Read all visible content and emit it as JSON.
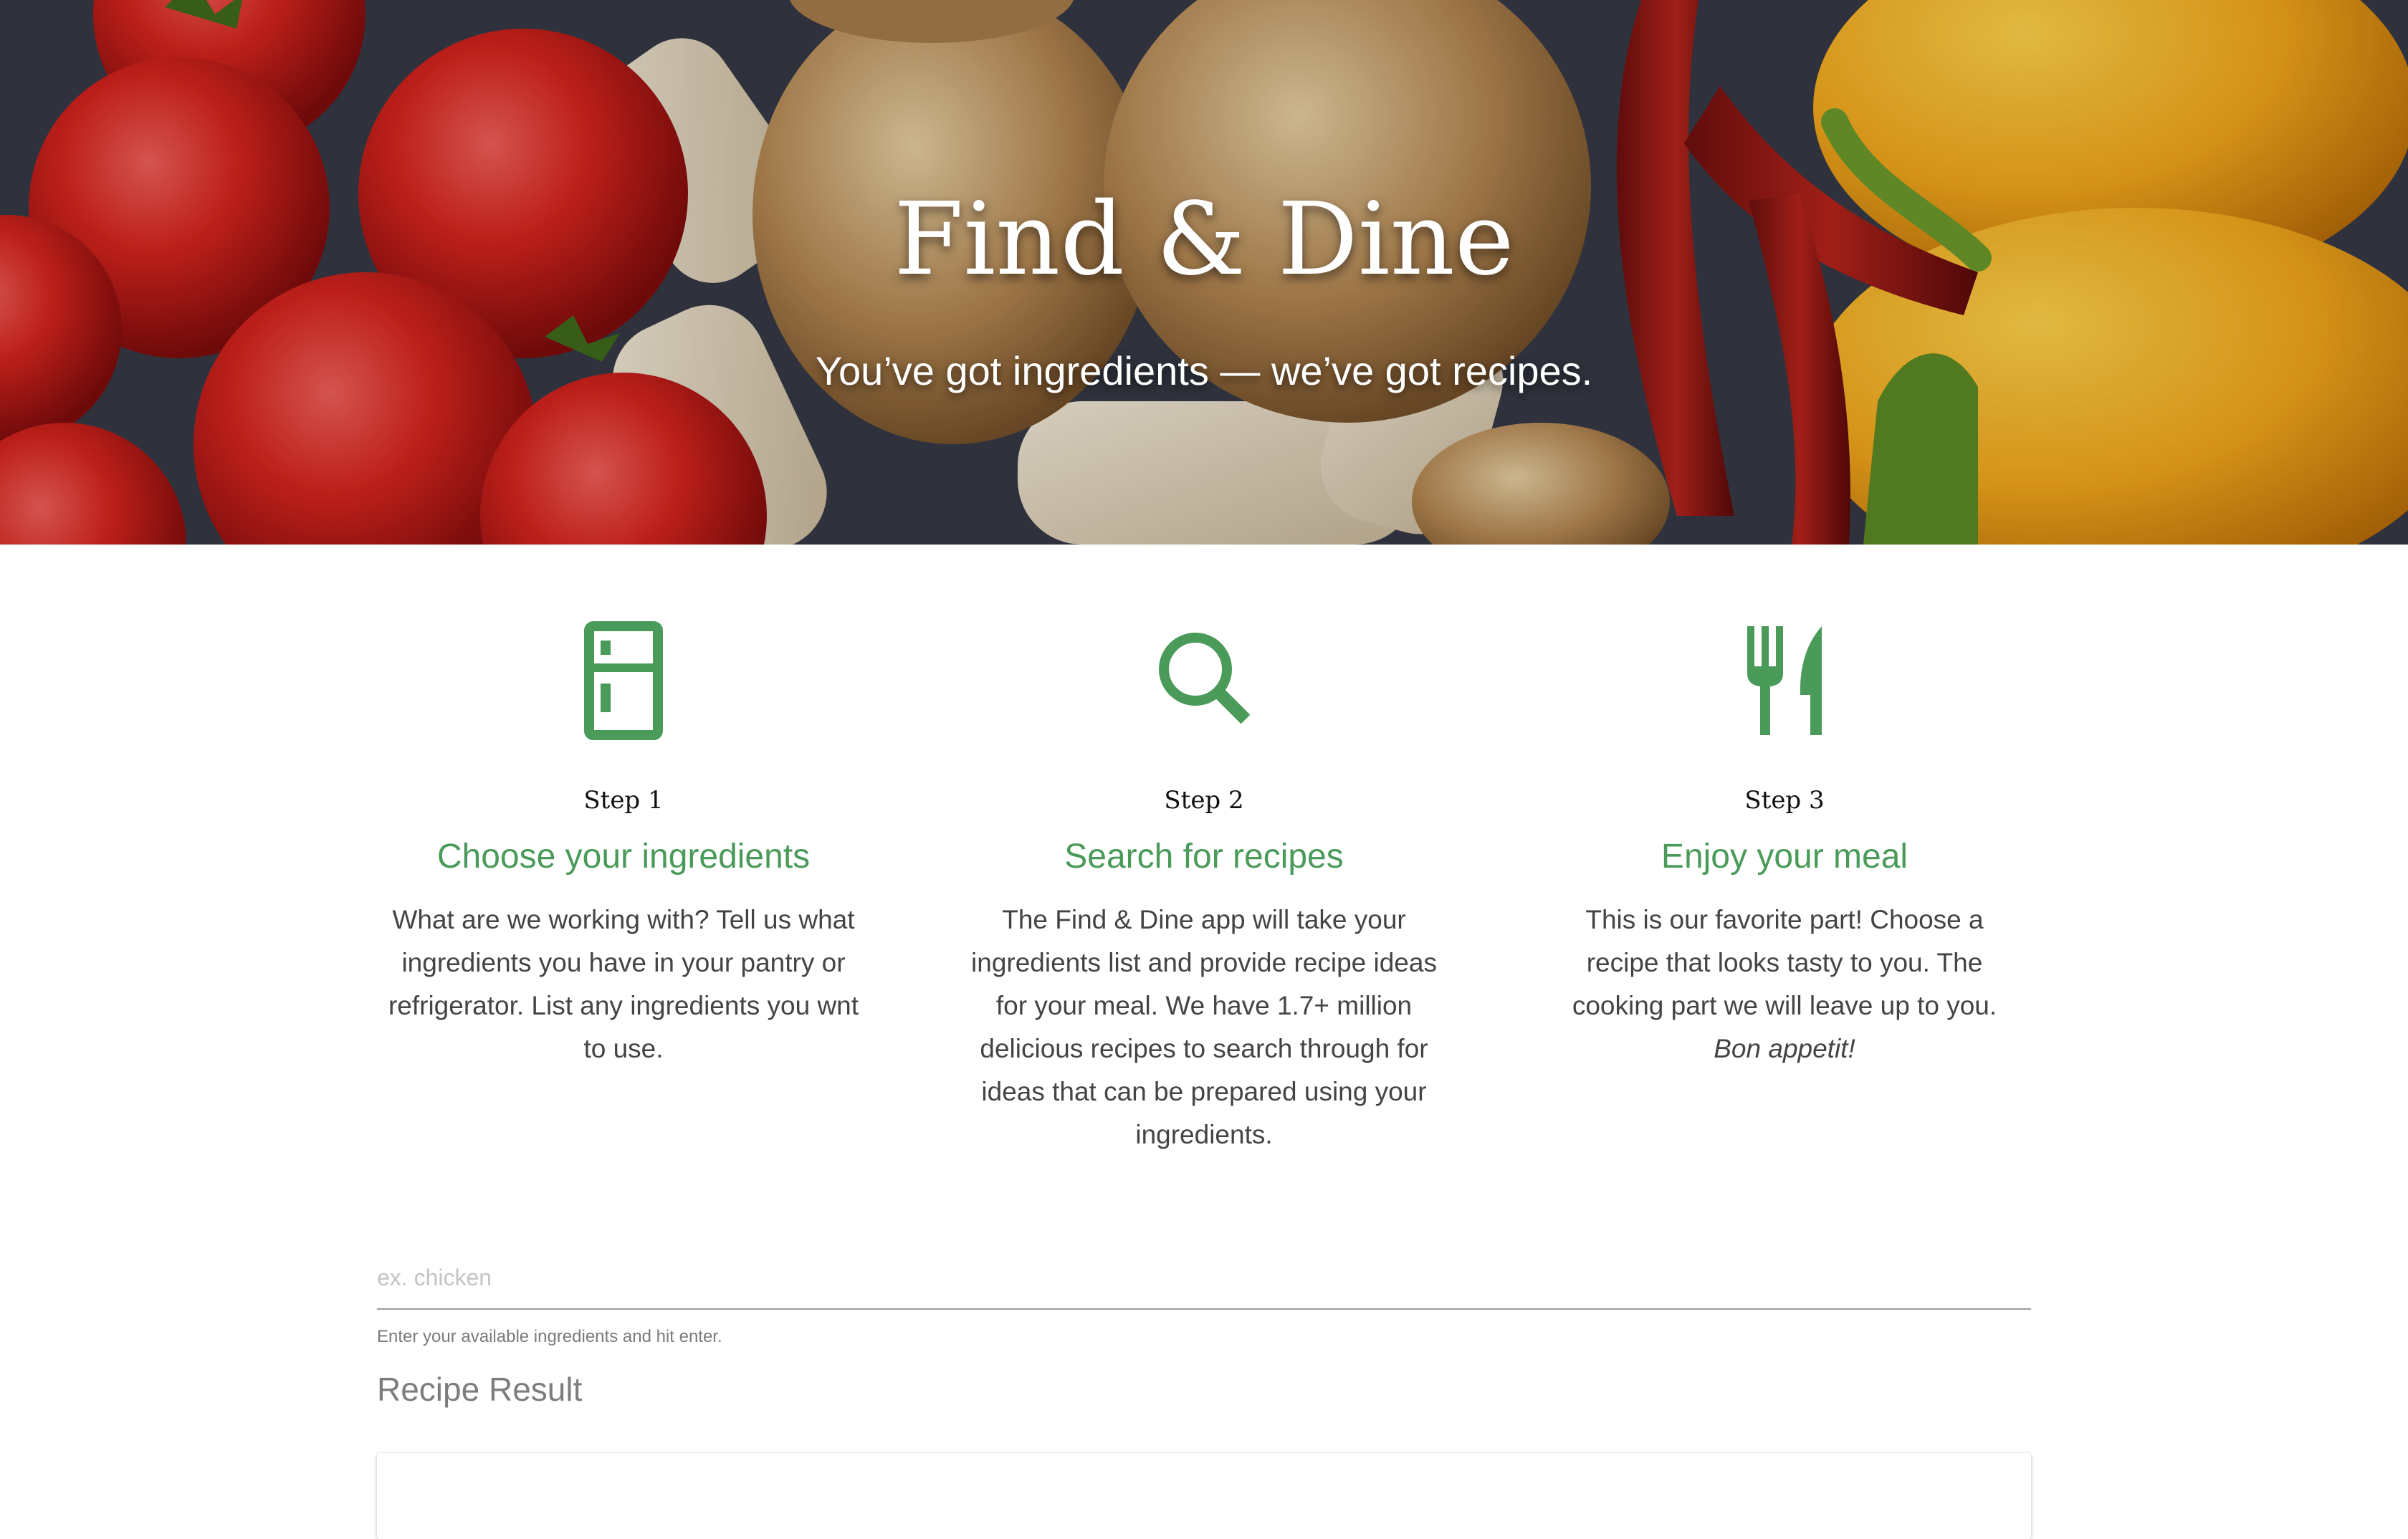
{
  "hero": {
    "title": "Find & Dine",
    "subtitle": "You’ve got ingredients — we’ve got recipes."
  },
  "steps": [
    {
      "icon": "refrigerator-icon",
      "number": "Step 1",
      "title": "Choose your ingredients",
      "description": "What are we working with? Tell us what ingredients you have in your pantry or refrigerator. List any ingredients you wnt to use."
    },
    {
      "icon": "search-icon",
      "number": "Step 2",
      "title": "Search for recipes",
      "description": "The Find & Dine app will take your ingredients list and provide recipe ideas for your meal. We have 1.7+ million delicious recipes to search through for ideas that can be prepared using your ingredients."
    },
    {
      "icon": "utensils-icon",
      "number": "Step 3",
      "title": "Enjoy your meal",
      "description": "This is our favorite part! Choose a recipe that looks tasty to you. The cooking part we will leave up to you.",
      "description_emphasis": "Bon appetit!"
    }
  ],
  "search": {
    "placeholder": "ex. chicken",
    "value": "",
    "hint": "Enter your available ingredients and hit enter."
  },
  "results": {
    "heading": "Recipe Result"
  },
  "colors": {
    "accent": "#4a9a5a",
    "body_text": "#444444",
    "muted_text": "#7d7d7d"
  }
}
